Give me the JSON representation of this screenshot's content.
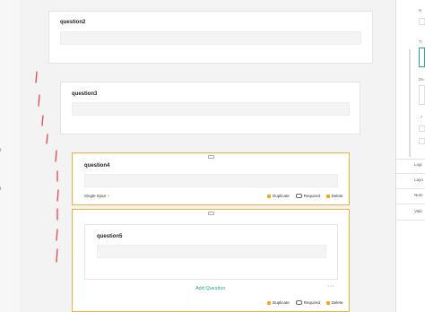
{
  "left_marks": [
    "t",
    "t"
  ],
  "questions": [
    {
      "title": "question2"
    },
    {
      "title": "question3"
    },
    {
      "title": "question4"
    },
    {
      "title": "question5"
    }
  ],
  "q4_footer": {
    "type_label": "Single Input",
    "duplicate": "Duplicate",
    "required": "Required",
    "delete": "Delete"
  },
  "q5_footer": {
    "add_question": "Add Question",
    "more": "···",
    "duplicate": "Duplicate",
    "required": "Required",
    "delete": "Delete"
  },
  "right_panel": {
    "top_labels": [
      "N",
      "Ti",
      "De"
    ],
    "nav_items": [
      "Logi",
      "Layo",
      "Num",
      "Valic"
    ]
  },
  "colors": {
    "accent": "#f3a71f",
    "teal": "#2aa58e",
    "pen_mark": "#e8434f"
  }
}
